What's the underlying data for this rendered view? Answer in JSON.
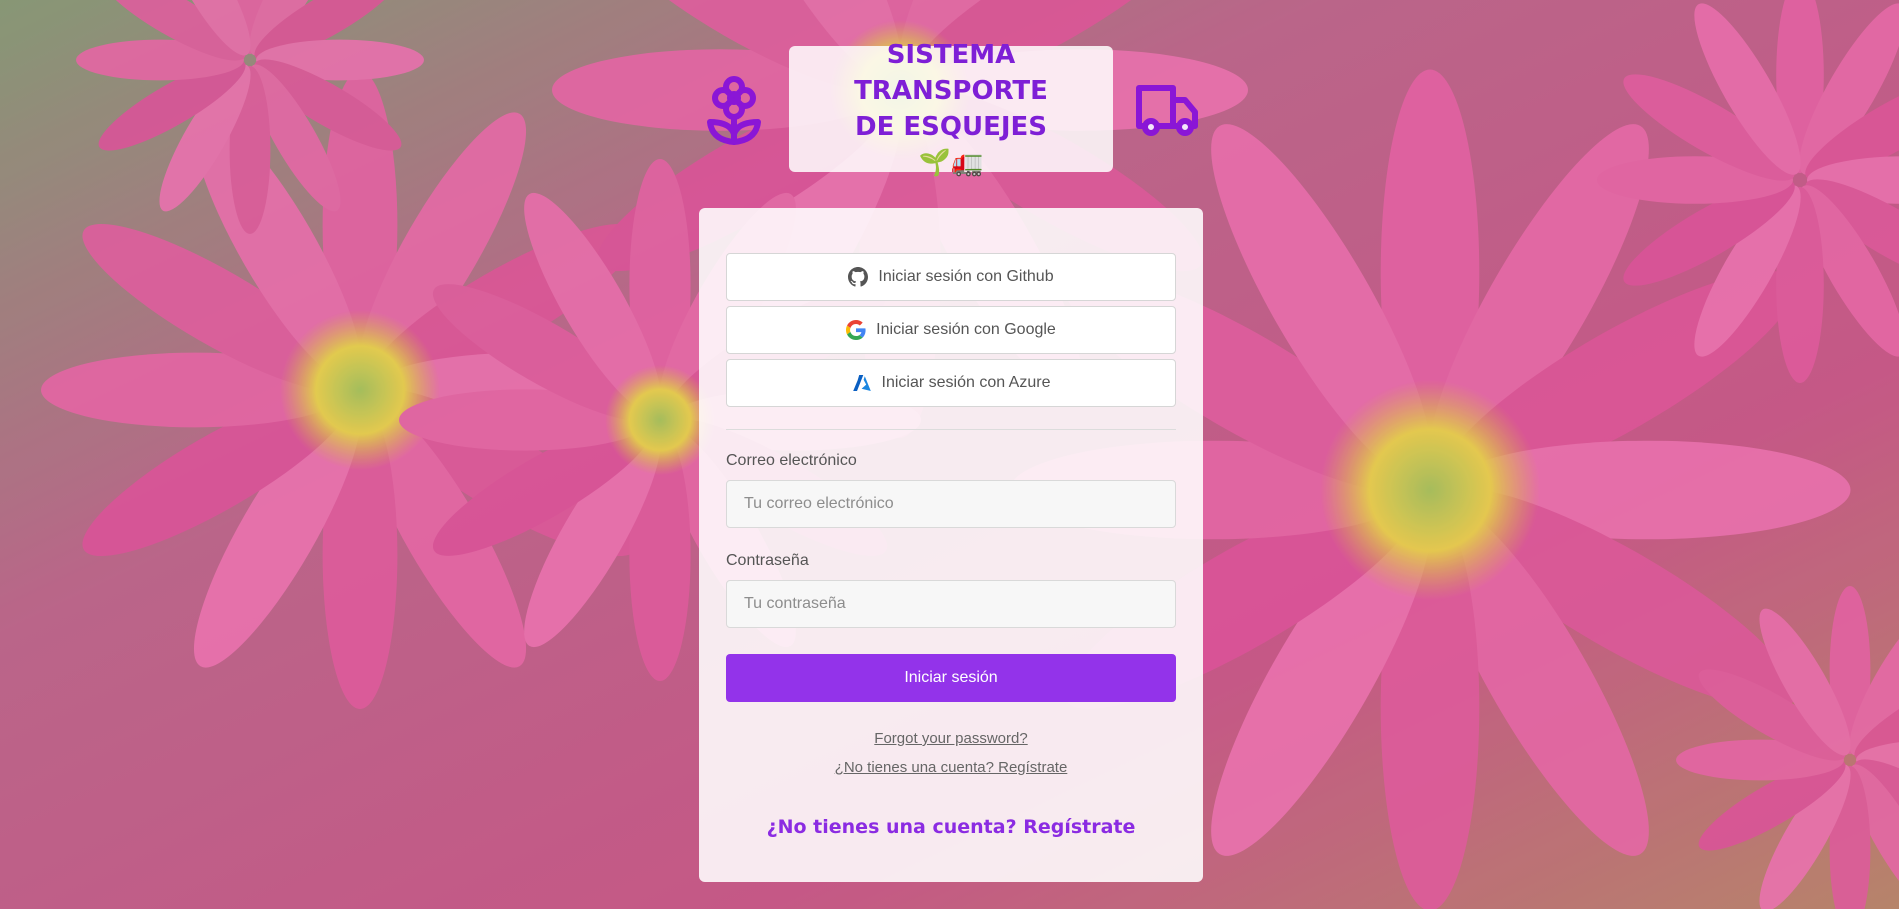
{
  "header": {
    "title": "SISTEMA TRANSPORTE DE ESQUEJES 🌱🚛",
    "left_icon": "flower-icon",
    "right_icon": "truck-icon",
    "accent_color": "#7e1fd6"
  },
  "auth": {
    "providers": [
      {
        "label": "Iniciar sesión con Github",
        "icon": "github-icon"
      },
      {
        "label": "Iniciar sesión con Google",
        "icon": "google-icon"
      },
      {
        "label": "Iniciar sesión con Azure",
        "icon": "azure-icon"
      }
    ],
    "email": {
      "label": "Correo electrónico",
      "placeholder": "Tu correo electrónico",
      "value": ""
    },
    "password": {
      "label": "Contraseña",
      "placeholder": "Tu contraseña",
      "value": ""
    },
    "submit_label": "Iniciar sesión",
    "submit_color": "#9333ea",
    "forgot_link": "Forgot your password?",
    "register_link": "¿No tienes una cuenta? Regístrate",
    "register_cta": "¿No tienes una cuenta? Regístrate"
  }
}
